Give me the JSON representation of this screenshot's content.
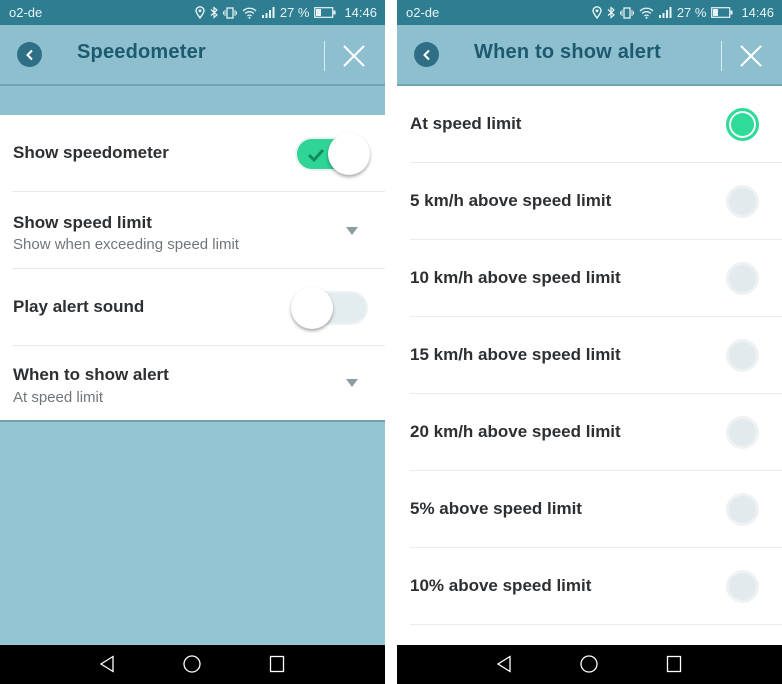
{
  "status_bar": {
    "carrier": "o2-de",
    "icons": [
      "location-icon",
      "bluetooth-icon",
      "vibrate-icon",
      "wifi-icon",
      "signal-icon"
    ],
    "battery_percent": "27 %",
    "battery_level": 0.27,
    "time": "14:46"
  },
  "left_screen": {
    "title": "Speedometer",
    "back_icon": "chevron-left-icon",
    "close_icon": "close-icon",
    "settings": [
      {
        "title": "Show speedometer",
        "type": "toggle",
        "value": true
      },
      {
        "title": "Show speed limit",
        "subtitle": "Show when exceeding speed limit",
        "type": "dropdown"
      },
      {
        "title": "Play alert sound",
        "type": "toggle",
        "value": false
      },
      {
        "title": "When to show alert",
        "subtitle": "At speed limit",
        "type": "dropdown"
      }
    ]
  },
  "right_screen": {
    "title": "When to show alert",
    "back_icon": "chevron-left-icon",
    "close_icon": "close-icon",
    "options": [
      {
        "label": "At speed limit",
        "selected": true
      },
      {
        "label": "5 km/h above speed limit",
        "selected": false
      },
      {
        "label": "10 km/h above speed limit",
        "selected": false
      },
      {
        "label": "15 km/h above speed limit",
        "selected": false
      },
      {
        "label": "20 km/h above speed limit",
        "selected": false
      },
      {
        "label": "5% above speed limit",
        "selected": false
      },
      {
        "label": "10% above speed limit",
        "selected": false
      }
    ]
  },
  "nav_bar": {
    "buttons": [
      "back-triangle-icon",
      "home-circle-icon",
      "recents-square-icon"
    ]
  },
  "colors": {
    "accent_green": "#2ed596",
    "status_bar": "#2f7d90",
    "app_bar": "#8dbfcf",
    "title_text": "#1e5a6f",
    "background_teal": "#94c5d3"
  }
}
